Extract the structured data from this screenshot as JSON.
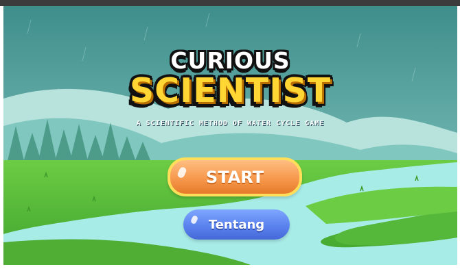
{
  "title": {
    "line1": "CURIOUS",
    "line2": "SCIENTIST",
    "subtitle": "A SCIENTIFIC METHOD OF WATER CYCLE GAME"
  },
  "menu": {
    "start_label": "START",
    "about_label": "Tentang"
  },
  "colors": {
    "sky_top": "#3f8e8c",
    "sky_bottom": "#9ed8d2",
    "grass": "#5cc13f",
    "river": "#a8ece8",
    "start_button": "#f6994d",
    "about_button": "#5a83ee",
    "logo_yellow": "#ffd633"
  }
}
